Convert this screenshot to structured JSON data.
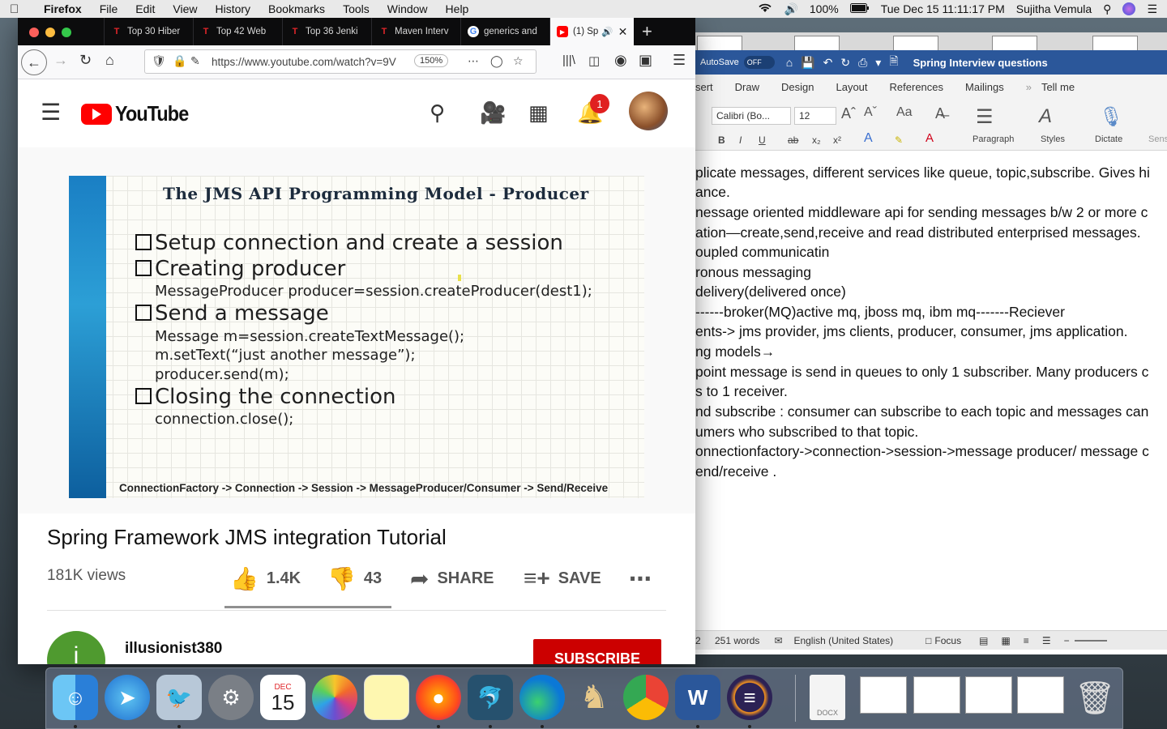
{
  "menubar": {
    "app": "Firefox",
    "items": [
      "File",
      "Edit",
      "View",
      "History",
      "Bookmarks",
      "Tools",
      "Window",
      "Help"
    ],
    "battery": "100%",
    "clock": "Tue Dec 15  11:11:17 PM",
    "user": "Sujitha Vemula"
  },
  "firefox": {
    "tabs": [
      {
        "label": "Top 30 Hiber",
        "fav": "T",
        "fav_color": "#e0262a"
      },
      {
        "label": "Top 42 Web",
        "fav": "T",
        "fav_color": "#e0262a"
      },
      {
        "label": "Top 36 Jenki",
        "fav": "T",
        "fav_color": "#e0262a"
      },
      {
        "label": "Maven Interv",
        "fav": "T",
        "fav_color": "#e0262a"
      },
      {
        "label": "generics and",
        "fav": "G",
        "fav_color": "#4285f4"
      },
      {
        "label": "(1) Sp",
        "fav": "▶",
        "fav_color": "#ff0000"
      }
    ],
    "url": "https://www.youtube.com/watch?v=9V",
    "zoom": "150%"
  },
  "youtube": {
    "logo": "YouTube",
    "notifications": "1",
    "slide": {
      "title": "The JMS API Programming Model  - Producer",
      "bullets": [
        "Setup connection and create a session",
        "Creating producer",
        "Send a message",
        "Closing the connection"
      ],
      "code": [
        "MessageProducer producer=session.createProducer(dest1);",
        "Message m=session.createTextMessage();",
        "m.setText(“just another message”);",
        "producer.send(m);",
        "connection.close();"
      ],
      "footer": "ConnectionFactory -> Connection  -> Session  -> MessageProducer/Consumer  -> Send/Receive"
    },
    "video_title": "Spring Framework JMS integration Tutorial",
    "views": "181K views",
    "likes": "1.4K",
    "dislikes": "43",
    "share": "SHARE",
    "save": "SAVE",
    "channel": "illusionist380",
    "channel_initial": "i",
    "subscribe": "SUBSCRIBE"
  },
  "word": {
    "autosave": "AutoSave",
    "autosave_state": "OFF",
    "doc_title": "Spring Interview questions",
    "tabs": [
      "sert",
      "Draw",
      "Design",
      "Layout",
      "References",
      "Mailings",
      "»",
      "Tell me"
    ],
    "font": "Calibri (Bo...",
    "size": "12",
    "groups": [
      "Paragraph",
      "Styles",
      "Dictate",
      "Sens"
    ],
    "lines": [
      "plicate messages, different services like queue, topic,subscribe. Gives hi",
      "ance.",
      "nessage oriented middleware api for sending messages b/w 2 or more c",
      "ation—create,send,receive and read distributed enterprised messages.",
      "oupled communicatin",
      "ronous messaging",
      "delivery(delivered once)",
      "------broker(MQ)active mq, jboss mq, ibm mq-------Reciever",
      "ents-> jms provider, jms clients, producer, consumer, jms application.",
      "ng models→",
      " point message is send in queues to only 1 subscriber. Many producers c",
      "s to 1 receiver.",
      "nd subscribe : consumer can subscribe to each topic and messages can",
      "umers who subscribed to that topic.",
      "onnectionfactory->connection->session->message producer/ message c",
      "end/receive ."
    ],
    "status": {
      "page": "2",
      "words": "251 words",
      "language": "English (United States)",
      "focus": "Focus"
    }
  },
  "dock": {
    "calendar_month": "DEC",
    "calendar_day": "15",
    "docx_label": "DOCX"
  }
}
